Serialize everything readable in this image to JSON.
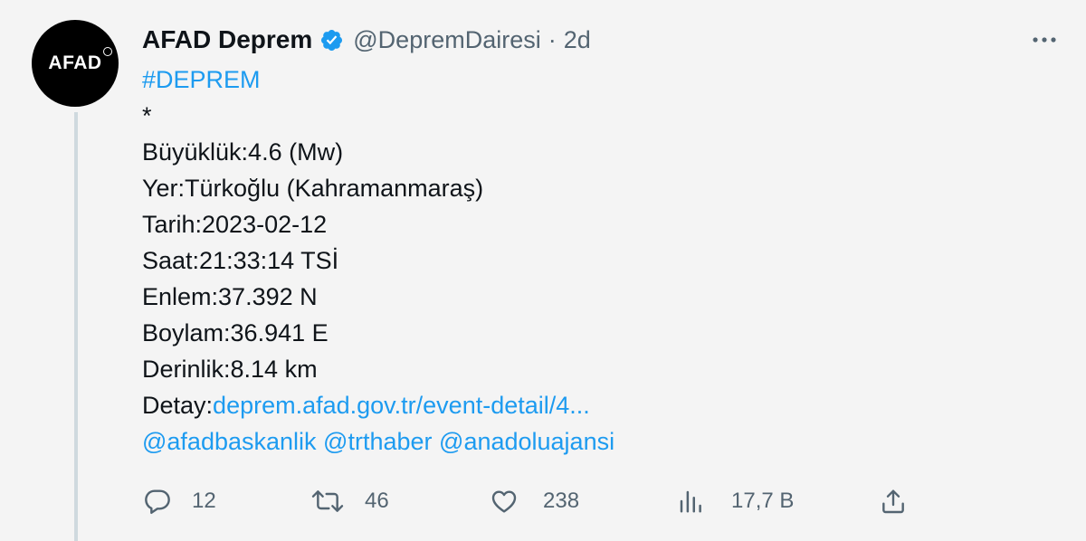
{
  "colors": {
    "link": "#1d9bf0",
    "verified": "#1d9bf0",
    "muted": "#536471",
    "text": "#0f1419",
    "avatar_bg": "#000000"
  },
  "avatar": {
    "text": "AFAD"
  },
  "author": {
    "display_name": "AFAD Deprem",
    "verified_icon": "verified-badge-icon",
    "handle": "@DepremDairesi",
    "separator": "·",
    "time": "2d"
  },
  "menu": {
    "icon": "more-options-icon"
  },
  "tweet": {
    "hashtag": "#DEPREM",
    "asterisk": "*",
    "fields": [
      "Büyüklük:4.6 (Mw)",
      "Yer:Türkoğlu (Kahramanmaraş)",
      "Tarih:2023-02-12",
      "Saat:21:33:14 TSİ",
      "Enlem:37.392 N",
      "Boylam:36.941 E",
      "Derinlik:8.14 km"
    ],
    "detail_label": "Detay:",
    "detail_link": "deprem.afad.gov.tr/event-detail/4...",
    "mentions": [
      "@afadbaskanlik",
      "@trthaber",
      "@anadoluajansi"
    ]
  },
  "actions": {
    "reply": {
      "icon": "reply-icon",
      "count": "12"
    },
    "retweet": {
      "icon": "retweet-icon",
      "count": "46"
    },
    "like": {
      "icon": "like-icon",
      "count": "238"
    },
    "views": {
      "icon": "views-icon",
      "count": "17,7 B"
    },
    "share": {
      "icon": "share-icon"
    }
  }
}
